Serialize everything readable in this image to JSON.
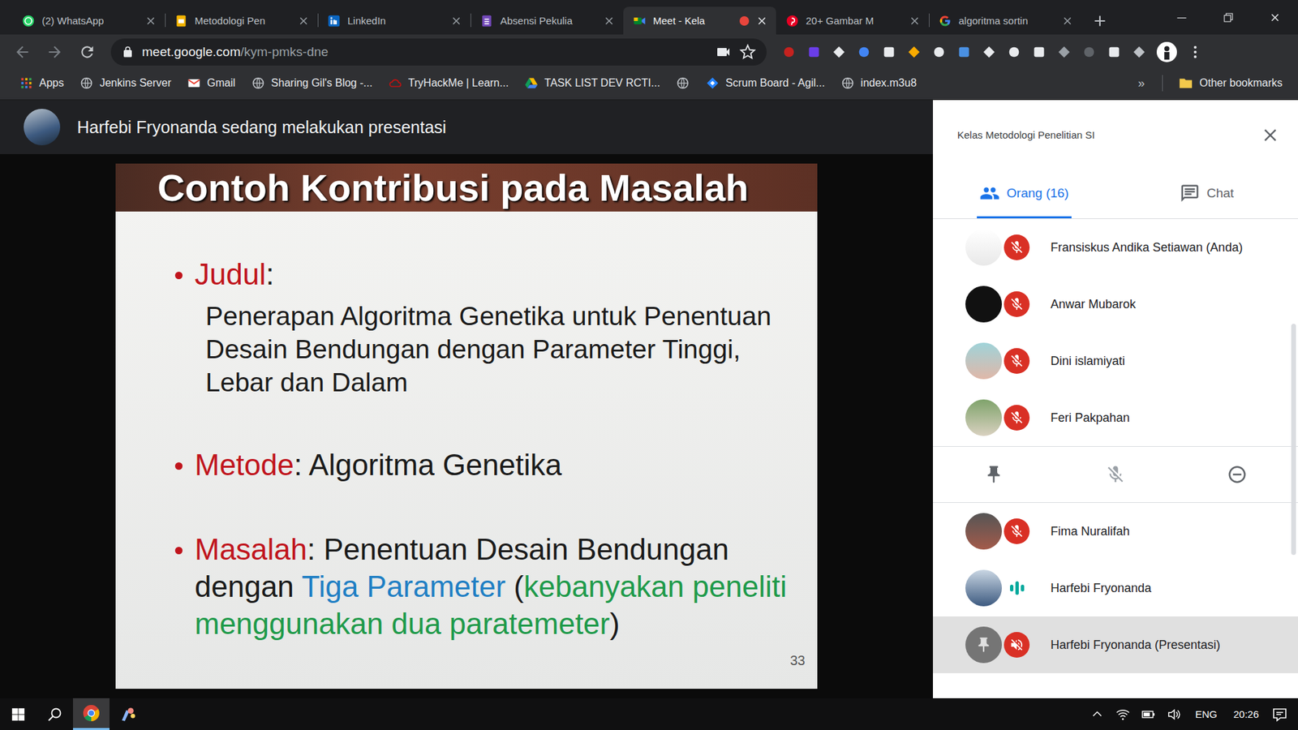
{
  "browser": {
    "tabs": [
      {
        "label": "(2) WhatsApp",
        "kind": "whatsapp",
        "selected": false,
        "recording": false
      },
      {
        "label": "Metodologi Pen",
        "kind": "slides",
        "selected": false,
        "recording": false
      },
      {
        "label": "LinkedIn",
        "kind": "linkedin",
        "selected": false,
        "recording": false
      },
      {
        "label": "Absensi Pekulia",
        "kind": "forms",
        "selected": false,
        "recording": false
      },
      {
        "label": "Meet - Kela",
        "kind": "meet",
        "selected": true,
        "recording": true
      },
      {
        "label": "20+ Gambar M",
        "kind": "pinterest",
        "selected": false,
        "recording": false
      },
      {
        "label": "algoritma sortin",
        "kind": "google",
        "selected": false,
        "recording": false
      }
    ],
    "address": {
      "host": "meet.google.com",
      "path": "/kym-pmks-dne"
    },
    "bookmarks": [
      {
        "label": "Apps",
        "kind": "apps"
      },
      {
        "label": "Jenkins Server",
        "kind": "globe"
      },
      {
        "label": "Gmail",
        "kind": "gmail"
      },
      {
        "label": "Sharing Gil's Blog -...",
        "kind": "globe"
      },
      {
        "label": "TryHackMe | Learn...",
        "kind": "thm"
      },
      {
        "label": "TASK LIST DEV RCTI...",
        "kind": "drive"
      },
      {
        "kind": "globe"
      },
      {
        "label": "Scrum Board - Agil...",
        "kind": "scrum"
      },
      {
        "label": "index.m3u8",
        "kind": "globe"
      }
    ],
    "overflow": "»",
    "other_bookmarks": "Other bookmarks"
  },
  "meet": {
    "banner": "Harfebi Fryonanda sedang melakukan presentasi",
    "slide": {
      "title": "Contoh Kontribusi pada Masalah",
      "page": "33",
      "bullets": [
        {
          "segments": [
            {
              "text": "Judul",
              "color": "#c0141c"
            },
            {
              "text": ":",
              "color": "#1a1a1a"
            }
          ],
          "lines": [
            "Penerapan Algoritma Genetika untuk Penentuan",
            "Desain Bendungan dengan Parameter Tinggi,",
            "Lebar dan Dalam"
          ]
        },
        {
          "segments": [
            {
              "text": "Metode",
              "color": "#c0141c"
            },
            {
              "text": ": Algoritma Genetika",
              "color": "#1a1a1a"
            }
          ],
          "lines": []
        },
        {
          "segments": [
            {
              "text": "Masalah",
              "color": "#c0141c"
            },
            {
              "text": ": Penentuan Desain Bendungan dengan ",
              "color": "#1a1a1a"
            },
            {
              "text": "Tiga Parameter",
              "color": "#1f7fc4"
            },
            {
              "text": " (",
              "color": "#1a1a1a"
            },
            {
              "text": "kebanyakan peneliti menggunakan dua paratemeter",
              "color": "#1e9a4a"
            },
            {
              "text": ")",
              "color": "#1a1a1a"
            }
          ],
          "lines": []
        }
      ]
    }
  },
  "panel": {
    "title": "Kelas Metodologi Penelitian SI",
    "tabs": [
      {
        "label": "Orang (16)",
        "kind": "people",
        "selected": true
      },
      {
        "label": "Chat",
        "kind": "chat",
        "selected": false
      }
    ],
    "participants": [
      {
        "name": "Fransiskus Andika Setiawan (Anda)",
        "kind": "person",
        "muted": true,
        "speaking": false,
        "selected": false,
        "expanded": false
      },
      {
        "name": "Anwar Mubarok",
        "kind": "person",
        "muted": true,
        "speaking": false,
        "selected": false,
        "expanded": false
      },
      {
        "name": "Dini islamiyati",
        "kind": "person",
        "muted": true,
        "speaking": false,
        "selected": false,
        "expanded": false
      },
      {
        "name": "Feri Pakpahan",
        "kind": "person",
        "muted": true,
        "speaking": false,
        "selected": false,
        "expanded": true
      },
      {
        "name": "Fima Nuralifah",
        "kind": "person",
        "muted": true,
        "speaking": false,
        "selected": false,
        "expanded": false
      },
      {
        "name": "Harfebi Fryonanda",
        "kind": "person",
        "muted": false,
        "speaking": true,
        "selected": false,
        "expanded": false
      },
      {
        "name": "Harfebi Fryonanda (Presentasi)",
        "kind": "presentation",
        "muted": true,
        "speaking": false,
        "selected": true,
        "expanded": false
      }
    ]
  },
  "taskbar": {
    "apps": [
      {
        "kind": "chrome",
        "selected": true
      },
      {
        "kind": "paint",
        "selected": false
      }
    ],
    "language": "ENG",
    "time": "20:26"
  }
}
